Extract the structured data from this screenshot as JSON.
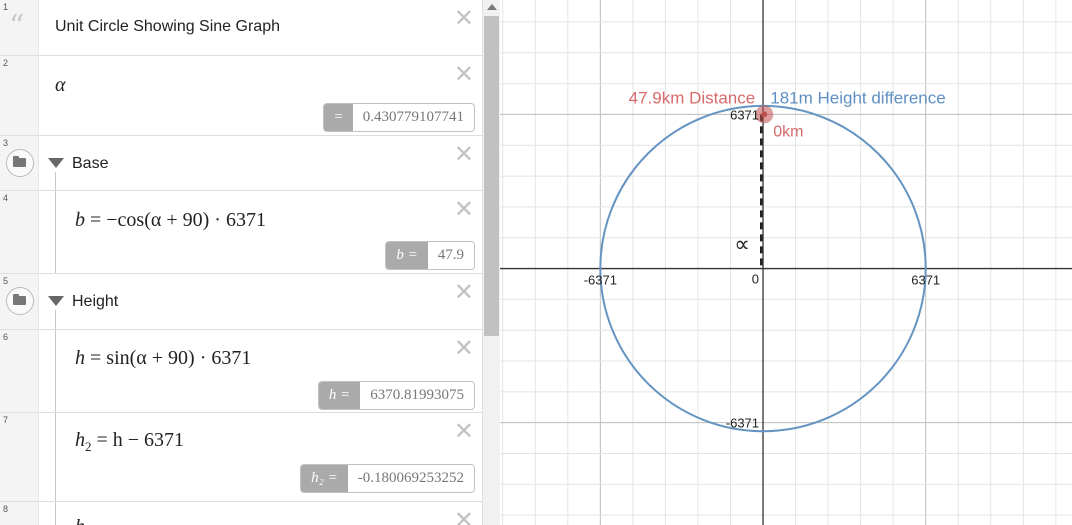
{
  "expressions": [
    {
      "num": "1",
      "type": "note",
      "icon": "quote-icon",
      "text": "Unit Circle Showing Sine Graph"
    },
    {
      "num": "2",
      "type": "expression",
      "var": "α",
      "eval_lhs": "=",
      "eval_value": "0.430779107741"
    },
    {
      "num": "3",
      "type": "folder",
      "title": "Base"
    },
    {
      "num": "4",
      "type": "expression",
      "lhs": "b",
      "rhs": "= −cos(α + 90) · 6371",
      "eval_lhs": "b =",
      "eval_value": "47.9"
    },
    {
      "num": "5",
      "type": "folder",
      "title": "Height"
    },
    {
      "num": "6",
      "type": "expression",
      "lhs": "h",
      "rhs": "= sin(α + 90) · 6371",
      "eval_lhs": "h =",
      "eval_value": "6370.81993075"
    },
    {
      "num": "7",
      "type": "expression",
      "lhs": "h",
      "lhs_sub": "2",
      "rhs": "= h − 6371",
      "eval_lhs": "h₂ =",
      "eval_value": "-0.180069253252"
    },
    {
      "num": "8",
      "type": "expression",
      "lhs": "h",
      "rhs": ""
    }
  ],
  "delete_icon": "close-icon",
  "graph": {
    "x_ticks": [
      "-6371",
      "0",
      "6371"
    ],
    "y_ticks": [
      "6371",
      "-6371"
    ],
    "labels": {
      "distance": "47.9km Distance",
      "height": "181m Height difference",
      "zero": "0km",
      "alpha": "∝"
    },
    "colors": {
      "circle": "#6594c2",
      "point": "#c0504d",
      "distance_label": "#d76a6a",
      "height_label": "#5f8fc2"
    },
    "chart_data": {
      "type": "parametric",
      "shape": "circle",
      "radius": 6371,
      "center": [
        0,
        0
      ],
      "point": [
        47.9,
        6370.82
      ],
      "xlim": [
        -10300,
        12100
      ],
      "ylim": [
        -10600,
        11100
      ]
    }
  }
}
